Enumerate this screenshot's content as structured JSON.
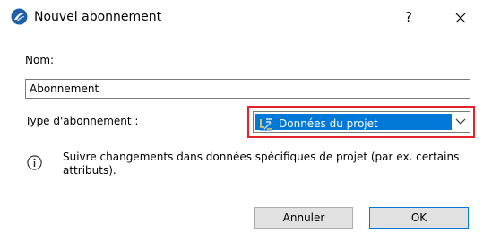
{
  "window": {
    "title": "Nouvel abonnement",
    "help_label": "?",
    "icons": {
      "app": "archicad-icon",
      "close": "close-icon"
    }
  },
  "form": {
    "name_label": "Nom:",
    "name_value": "Abonnement",
    "type_label": "Type d'abonnement :",
    "type_selected": "Données du projet",
    "type_icon": "project-data-icon",
    "highlight_color": "#e3232c",
    "selection_color": "#0078d7"
  },
  "info": {
    "icon": "info-icon",
    "text": "Suivre changements dans données spécifiques de projet (par ex. certains attributs)."
  },
  "buttons": {
    "cancel_label": "Annuler",
    "ok_label": "OK"
  }
}
